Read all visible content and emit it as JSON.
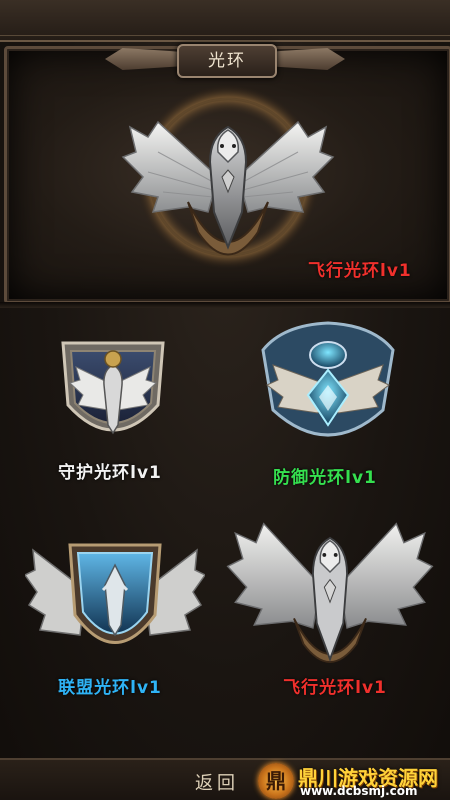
{
  "header": {
    "title": "光环"
  },
  "feature": {
    "label": "飞行光环lv1",
    "label_color": "#f0302c"
  },
  "auras": [
    {
      "label": "守护光环lv1",
      "color": "#f2f2f2",
      "emblem": "guardian-shield-eagle"
    },
    {
      "label": "防御光环lv1",
      "color": "#35e04f",
      "emblem": "defense-blue-wing-shield"
    },
    {
      "label": "联盟光环lv1",
      "color": "#2fb3f5",
      "emblem": "alliance-winged-shield"
    },
    {
      "label": "飞行光环lv1",
      "color": "#f0302c",
      "emblem": "flight-eagle-wings"
    }
  ],
  "footer": {
    "back_label": "返回"
  },
  "watermark": {
    "logo_char": "鼎",
    "title": "鼎川游戏资源网",
    "url": "www.dcbsmj.com"
  }
}
